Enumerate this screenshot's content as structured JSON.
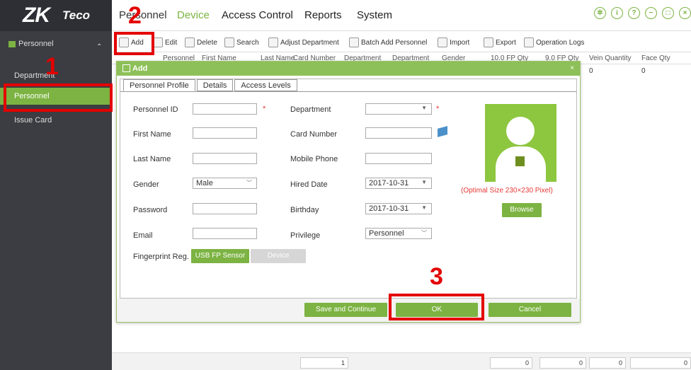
{
  "brand": {
    "logo_main": "ZK",
    "logo_sub": "Teco"
  },
  "topnav": {
    "tabs": [
      "Personnel",
      "Device",
      "Access Control",
      "Reports",
      "System"
    ]
  },
  "sidebar": {
    "header": "Personnel",
    "items": [
      "Department",
      "Personnel",
      "Issue Card"
    ]
  },
  "toolbar": {
    "items": [
      "Add",
      "Edit",
      "Delete",
      "Search",
      "Adjust Department",
      "Batch Add Personnel",
      "Import",
      "Export",
      "Operation Logs"
    ]
  },
  "grid": {
    "headers": [
      "Personnel",
      "First Name",
      "Last Name",
      "Card Number",
      "Department",
      "Department",
      "Gender",
      "10.0 FP Qty",
      "9.0 FP Qty",
      "Vein Quantity",
      "Face Qty"
    ],
    "row": [
      "0",
      "0"
    ]
  },
  "bottombar": {
    "values": [
      "1",
      "0",
      "0",
      "0",
      "0"
    ]
  },
  "dialog": {
    "title": "Add",
    "close": "×",
    "tabs": [
      "Personnel Profile",
      "Details",
      "Access Levels"
    ],
    "fields": {
      "personnel_id": {
        "label": "Personnel ID",
        "value": ""
      },
      "first_name": {
        "label": "First Name",
        "value": ""
      },
      "last_name": {
        "label": "Last Name",
        "value": ""
      },
      "gender": {
        "label": "Gender",
        "value": "Male"
      },
      "password": {
        "label": "Password",
        "value": ""
      },
      "email": {
        "label": "Email",
        "value": ""
      },
      "fingerprint": {
        "label": "Fingerprint Reg."
      },
      "department": {
        "label": "Department",
        "value": ""
      },
      "card_number": {
        "label": "Card Number",
        "value": ""
      },
      "mobile_phone": {
        "label": "Mobile Phone",
        "value": ""
      },
      "hired_date": {
        "label": "Hired Date",
        "value": "2017-10-31"
      },
      "birthday": {
        "label": "Birthday",
        "value": "2017-10-31"
      },
      "privilege": {
        "label": "Privilege",
        "value": "Personnel"
      }
    },
    "required_mark": "*",
    "optimal_size": "(Optimal Size 230×230 Pixel)",
    "buttons": {
      "usb": "USB FP Sensor",
      "device": "Device",
      "browse": "Browse",
      "save_continue": "Save and Continue",
      "ok": "OK",
      "cancel": "Cancel"
    }
  },
  "annotations": {
    "one": "1",
    "two": "2",
    "three": "3"
  },
  "colors": {
    "accent": "#7cb342",
    "annotation": "#e40000",
    "sidebar": "#3b3d42"
  }
}
